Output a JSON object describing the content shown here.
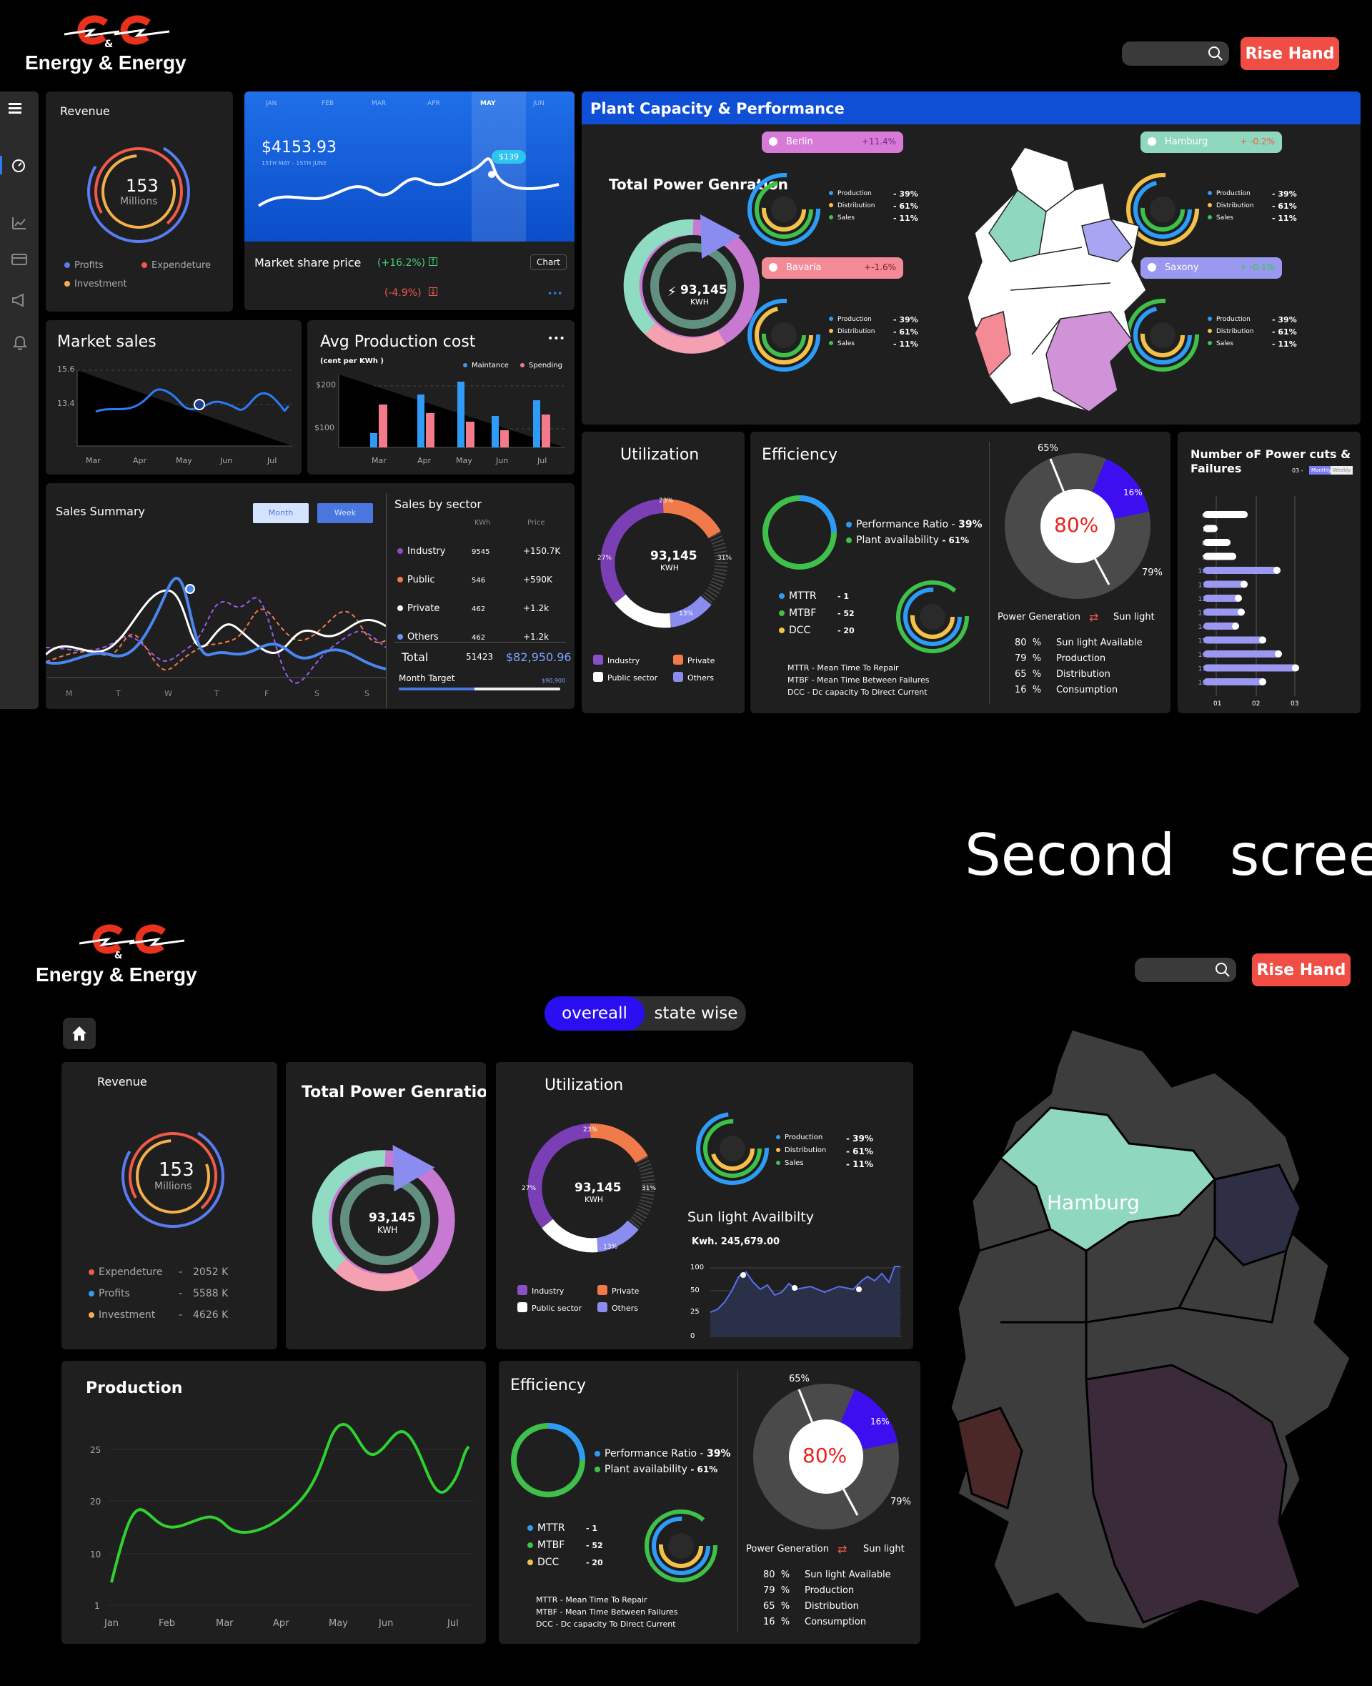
{
  "brand": {
    "name": "Energy & Energy",
    "amp": "&"
  },
  "header": {
    "rise_label": "Rise Hand"
  },
  "revenue": {
    "title": "Revenue",
    "value": "153",
    "unit": "Millions",
    "legend": [
      "Profits",
      "Expendeture",
      "Investment"
    ]
  },
  "market_share": {
    "months": [
      "JAN",
      "FEB",
      "MAR",
      "APR",
      "MAY",
      "JUN"
    ],
    "amount": "$4153.93",
    "range": "15TH MAY - 15TH JUNE",
    "bubble": "$139",
    "title": "Market share price",
    "up": "(+16.2%)",
    "down": "(-4.9%)",
    "chart_btn": "Chart",
    "more": "•••"
  },
  "market_sales": {
    "title": "Market sales",
    "y": [
      "15.6",
      "13.4"
    ],
    "x": [
      "Mar",
      "Apr",
      "May",
      "Jun",
      "Jul"
    ]
  },
  "avg_cost": {
    "title": "Avg Production cost",
    "sub": "(cent per KWh )",
    "legend": [
      "Maintance",
      "Spending"
    ],
    "y": [
      "$200",
      "$100"
    ],
    "x": [
      "Mar",
      "Apr",
      "May",
      "Jun",
      "Jul"
    ],
    "more": "•••"
  },
  "sales_summary": {
    "title": "Sales Summary",
    "tabs": [
      "Month",
      "Week"
    ],
    "x": [
      "M",
      "T",
      "W",
      "T",
      "F",
      "S",
      "S"
    ]
  },
  "sales_sector": {
    "title": "Sales by sector",
    "cols": [
      "KWh",
      "Price"
    ],
    "rows": [
      {
        "name": "Industry",
        "kwh": "9545",
        "price": "+150.7K",
        "color": "#8a4fc7"
      },
      {
        "name": "Public",
        "kwh": "546",
        "price": "+590K",
        "color": "#f07a4a"
      },
      {
        "name": "Private",
        "kwh": "462",
        "price": "+1.2k",
        "color": "#ffffff"
      },
      {
        "name": "Others",
        "kwh": "462",
        "price": "+1.2k",
        "color": "#6f8ff5"
      }
    ],
    "total_label": "Total",
    "total_kwh": "51423",
    "total_price": "$82,950.96",
    "target_label": "Month Target",
    "target_val": "$90,900"
  },
  "plant": {
    "title": "Plant Capacity & Performance",
    "tpg": "Total Power Genration",
    "center_val": "93,145",
    "center_unit": "KWH",
    "states": [
      {
        "name": "Berlin",
        "pct": "+11.4%"
      },
      {
        "name": "Hamburg",
        "pct": "+ -0.2%"
      },
      {
        "name": "Bavaria",
        "pct": "+-1.6%"
      },
      {
        "name": "Saxony",
        "pct": "+ -0.1%"
      }
    ],
    "rows": [
      {
        "label": "Production",
        "val": "- 39%"
      },
      {
        "label": "Distribution",
        "val": "- 61%"
      },
      {
        "label": "Sales",
        "val": "- 11%"
      }
    ]
  },
  "utilization": {
    "title": "Utilization",
    "center_val": "93,145",
    "center_unit": "KWH",
    "p1": "23%",
    "p2": "27%",
    "p3": "31%",
    "p4": "13%",
    "legend": [
      "Industry",
      "Private",
      "Public sector",
      "Others"
    ]
  },
  "efficiency": {
    "title": "Efficiency",
    "perf": "Performance Ratio -",
    "perf_val": "39%",
    "plant": "Plant availability",
    "plant_val": "-   61%",
    "metrics": [
      {
        "k": "MTTR",
        "v": "- 1"
      },
      {
        "k": "MTBF",
        "v": "- 52"
      },
      {
        "k": "DCC",
        "v": "- 20"
      }
    ],
    "notes": [
      "MTTR - Mean Time To Repair",
      "MTBF - Mean Time Between Failures",
      "DCC  - Dc capacity To Direct Current"
    ],
    "pie_center": "80%",
    "p65": "65%",
    "p16": "16%",
    "p79": "79%",
    "pg": "Power Generation",
    "sl": "Sun light",
    "stats": [
      {
        "p": "80  %",
        "l": "Sun light Available"
      },
      {
        "p": "79  %",
        "l": "Production"
      },
      {
        "p": "65  %",
        "l": "Distribution"
      },
      {
        "p": "16  %",
        "l": "Consumption"
      }
    ]
  },
  "power_cuts": {
    "title": "Number oF Power cuts &",
    "title2": "Failures",
    "sel": "03 -",
    "tabs": [
      "Monthly",
      "Weekly"
    ],
    "y": [
      "6",
      "7",
      "8",
      "9",
      "10",
      "11",
      "12",
      "13",
      "14",
      "15",
      "16",
      "17",
      "18"
    ],
    "x": [
      "01",
      "02",
      "03"
    ]
  },
  "second": {
    "heading": "Second   screen",
    "toggle": [
      "overeall",
      "state wise"
    ],
    "revenue_rows": [
      {
        "l": "Expendeture",
        "v": "2052 K"
      },
      {
        "l": "Profits",
        "v": "5588 K"
      },
      {
        "l": "Investment",
        "v": "4626 K"
      }
    ],
    "sun": "Sun light Availbilty",
    "kwh": "Kwh. 245,679.00",
    "sun_y": [
      "100",
      "50",
      "25",
      "0"
    ],
    "production": "Production",
    "prod_y": [
      "25",
      "20",
      "10",
      "1"
    ],
    "prod_x": [
      "Jan",
      "Feb",
      "Mar",
      "Apr",
      "May",
      "Jun",
      "Jul"
    ],
    "map_label": "Hamburg"
  }
}
